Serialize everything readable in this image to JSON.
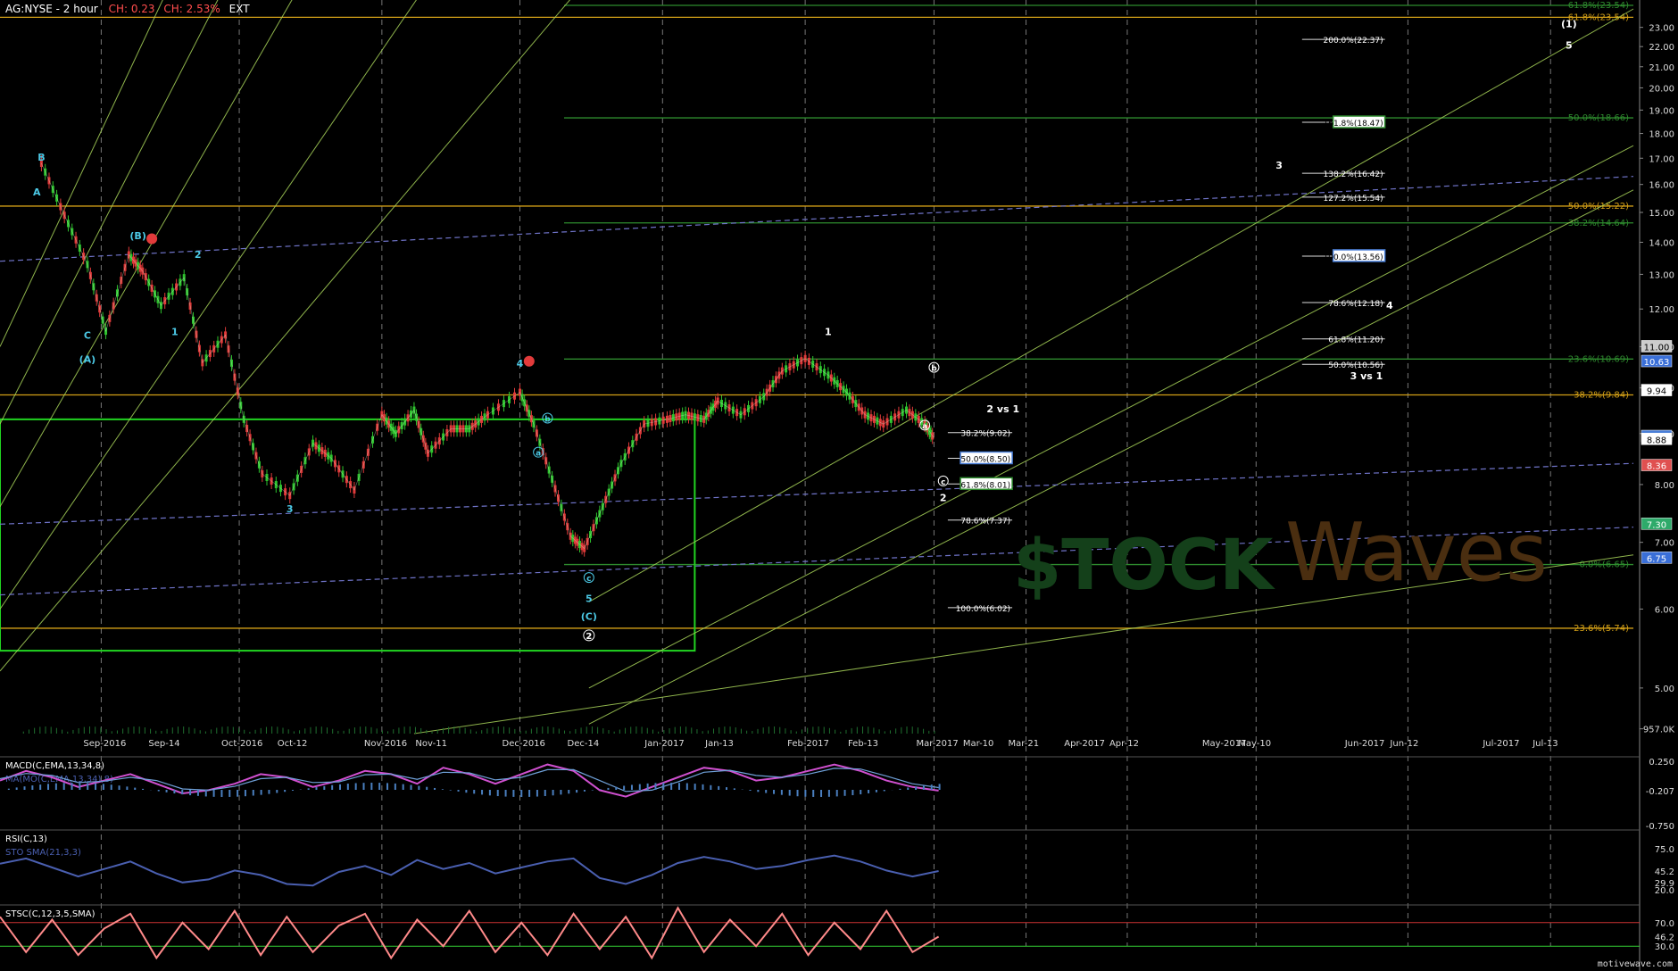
{
  "header": {
    "symbol": "AG:NYSE - 2 hour",
    "change_abs": "CH: 0.23",
    "change_pct": "CH: 2.53%",
    "session": "EXT",
    "ticker_tag": "AG"
  },
  "footer": {
    "brand": "motivewave.com"
  },
  "watermark": {
    "text_left": "$TOCK",
    "text_right": "Waves"
  },
  "colors": {
    "background": "#000000",
    "gold": "#d4a017",
    "green_line": "#2e8b2e",
    "box": "#21d421",
    "trend": "#a8d45a",
    "dashed_blue": "#6f73c8",
    "wave_cyan": "#4cc9e6",
    "alert_red": "#e23b3b",
    "macd": "#d050d0",
    "stsc": "#ff8a8a"
  },
  "chart_data": [
    {
      "type": "line",
      "title": "AG:NYSE - 2 hour",
      "price_axis": {
        "scale": "log",
        "ylim": [
          4.5,
          24.5
        ],
        "ticks": [
          "23.00",
          "22.00",
          "21.00",
          "20.00",
          "19.00",
          "18.00",
          "17.00",
          "16.00",
          "15.00",
          "14.00",
          "13.00",
          "12.00",
          "11.00",
          "10.00",
          "9.00",
          "8.00",
          "7.00",
          "6.00",
          "5.00",
          "957.0K"
        ],
        "labels": [
          {
            "text": "11.00",
            "value": 11.0,
            "color": "#cccccc"
          },
          {
            "text": "10.63",
            "value": 10.63,
            "color": "#3a6fd8"
          },
          {
            "text": "9.94",
            "value": 9.94,
            "color": "#ffffff"
          },
          {
            "text": "8.94",
            "value": 8.94,
            "color": "#4a7fd8"
          },
          {
            "text": "8.88",
            "value": 8.88,
            "color": "#ffffff"
          },
          {
            "text": "8.36",
            "value": 8.36,
            "color": "#e05050"
          },
          {
            "text": "7.30",
            "value": 7.3,
            "color": "#2eaa6a"
          },
          {
            "text": "6.75",
            "value": 6.75,
            "color": "#3a6fd8"
          }
        ]
      },
      "time_axis": {
        "labels": [
          "Sep-2016",
          "Sep-14",
          "Oct-2016",
          "Oct-12",
          "Nov-2016",
          "Nov-11",
          "Dec-2016",
          "Dec-14",
          "Jan-2017",
          "Jan-13",
          "Feb-2017",
          "Feb-13",
          "Mar-2017",
          "Mar-10",
          "Mar-21",
          "Apr-2017",
          "Apr-12",
          "May-2017",
          "May-10",
          "Jun-2017",
          "Jun-12",
          "Jul-2017",
          "Jul-13"
        ]
      },
      "series": [
        {
          "name": "AG",
          "x": [
            "Aug-19",
            "Aug-24",
            "Aug-29",
            "Sep-02",
            "Sep-07",
            "Sep-10",
            "Sep-14",
            "Sep-19",
            "Sep-23",
            "Sep-28",
            "Oct-02",
            "Oct-06",
            "Oct-12",
            "Oct-17",
            "Oct-21",
            "Oct-26",
            "Nov-01",
            "Nov-04",
            "Nov-08",
            "Nov-11",
            "Nov-16",
            "Nov-20",
            "Nov-24",
            "Dec-01",
            "Dec-04",
            "Dec-08",
            "Dec-12",
            "Dec-15",
            "Dec-19",
            "Dec-23",
            "Dec-28",
            "Jan-02",
            "Jan-06",
            "Jan-10",
            "Jan-13",
            "Jan-18",
            "Jan-23",
            "Jan-27",
            "Feb-01",
            "Feb-06",
            "Feb-10",
            "Feb-14",
            "Feb-18",
            "Feb-23",
            "Feb-27",
            "Mar-01"
          ],
          "values": [
            16.8,
            14.9,
            13.3,
            11.4,
            13.6,
            13.1,
            12.1,
            12.9,
            10.6,
            11.3,
            9.3,
            8.2,
            7.8,
            8.8,
            8.5,
            7.9,
            9.4,
            9.0,
            9.5,
            8.6,
            9.1,
            9.1,
            9.4,
            9.9,
            9.2,
            8.1,
            7.1,
            6.9,
            7.6,
            8.4,
            9.2,
            9.3,
            9.4,
            9.3,
            9.7,
            9.4,
            9.8,
            10.4,
            10.7,
            10.3,
            9.9,
            9.4,
            9.2,
            9.5,
            9.2,
            8.9
          ]
        }
      ],
      "horizontal_levels": [
        {
          "label": "61.8%(23.54)",
          "value": 23.54,
          "color": "#d4a017"
        },
        {
          "label": "50.0%(15.22)",
          "value": 15.22,
          "color": "#d4a017"
        },
        {
          "label": "38.2%(9.84)",
          "value": 9.84,
          "color": "#d4a017"
        },
        {
          "label": "23.6%(5.74)",
          "value": 5.74,
          "color": "#d4a017"
        },
        {
          "label": "61.8%(23.54)",
          "value": 24.2,
          "color": "#2e8b2e"
        },
        {
          "label": "50.0%(18.66)",
          "value": 18.66,
          "color": "#2e8b2e"
        },
        {
          "label": "38.2%(14.64)",
          "value": 14.64,
          "color": "#2e8b2e"
        },
        {
          "label": "23.6%(10.69)",
          "value": 10.69,
          "color": "#2e8b2e"
        },
        {
          "label": "0.0%(6.65)",
          "value": 6.65,
          "color": "#2e8b2e"
        }
      ],
      "fib_targets_upper": [
        {
          "label": "200.0%(22.37)",
          "value": 22.37,
          "boxed": false
        },
        {
          "label": "161.8%(18.47)",
          "value": 18.47,
          "boxed": true,
          "box_color": "#2e8b2e"
        },
        {
          "label": "138.2%(16.42)",
          "value": 16.42,
          "boxed": false
        },
        {
          "label": "127.2%(15.54)",
          "value": 15.54,
          "boxed": false
        },
        {
          "label": "100.0%(13.56)",
          "value": 13.56,
          "boxed": true,
          "box_color": "#4a7fd8"
        },
        {
          "label": "78.6%(12.18)",
          "value": 12.18,
          "boxed": false
        },
        {
          "label": "61.8%(11.20)",
          "value": 11.2,
          "boxed": false
        },
        {
          "label": "50.0%(10.56)",
          "value": 10.56,
          "boxed": false
        }
      ],
      "fib_targets_lower": [
        {
          "label": "38.2%(9.02)",
          "value": 9.02,
          "boxed": false
        },
        {
          "label": "50.0%(8.50)",
          "value": 8.5,
          "boxed": true,
          "box_color": "#4a7fd8"
        },
        {
          "label": "61.8%(8.01)",
          "value": 8.01,
          "boxed": true,
          "box_color": "#2e8b2e"
        },
        {
          "label": "78.6%(7.37)",
          "value": 7.37,
          "boxed": false
        },
        {
          "label": "100.0%(6.02)",
          "value": 6.02,
          "boxed": false
        }
      ],
      "wave_labels": [
        {
          "text": "B",
          "date": "Aug-19",
          "value": 16.9,
          "color": "#4cc9e6"
        },
        {
          "text": "A",
          "date": "Aug-18",
          "value": 15.6,
          "color": "#4cc9e6"
        },
        {
          "text": "C",
          "date": "Aug-29",
          "value": 11.2,
          "color": "#4cc9e6"
        },
        {
          "text": "(A)",
          "date": "Aug-29",
          "value": 10.6,
          "color": "#4cc9e6"
        },
        {
          "text": "(B)",
          "date": "Sep-09",
          "value": 14.1,
          "color": "#4cc9e6"
        },
        {
          "text": "1",
          "date": "Sep-17",
          "value": 11.3,
          "color": "#4cc9e6"
        },
        {
          "text": "2",
          "date": "Sep-22",
          "value": 13.5,
          "color": "#4cc9e6"
        },
        {
          "text": "3",
          "date": "Oct-12",
          "value": 7.5,
          "color": "#4cc9e6"
        },
        {
          "text": "4",
          "date": "Dec-01",
          "value": 10.5,
          "color": "#4cc9e6"
        },
        {
          "text": "a",
          "date": "Dec-05",
          "value": 8.55,
          "color": "#4cc9e6"
        },
        {
          "text": "b",
          "date": "Dec-07",
          "value": 9.25,
          "color": "#4cc9e6"
        },
        {
          "text": "c",
          "date": "Dec-16",
          "value": 6.4,
          "color": "#4cc9e6"
        },
        {
          "text": "5",
          "date": "Dec-16",
          "value": 6.1,
          "color": "#4cc9e6"
        },
        {
          "text": "(C)",
          "date": "Dec-16",
          "value": 5.85,
          "color": "#4cc9e6"
        },
        {
          "text": "2",
          "date": "Dec-16",
          "value": 5.6,
          "color": "#ffffff"
        },
        {
          "text": "1",
          "date": "Feb-06",
          "value": 11.3,
          "color": "#ffffff"
        },
        {
          "text": "a",
          "date": "Feb-27",
          "value": 9.1,
          "color": "#ffffff"
        },
        {
          "text": "b",
          "date": "Mar-01",
          "value": 10.4,
          "color": "#ffffff"
        },
        {
          "text": "c",
          "date": "Mar-03",
          "value": 8.0,
          "color": "#ffffff"
        },
        {
          "text": "2",
          "date": "Mar-03",
          "value": 7.7,
          "color": "#ffffff"
        },
        {
          "text": "2 vs 1",
          "date": "Mar-16",
          "value": 9.45,
          "color": "#ffffff"
        },
        {
          "text": "3",
          "date": "May-15",
          "value": 16.6,
          "color": "#ffffff"
        },
        {
          "text": "4",
          "date": "Jun-08",
          "value": 12.0,
          "color": "#ffffff"
        },
        {
          "text": "3 vs 1",
          "date": "Jun-03",
          "value": 10.2,
          "color": "#ffffff"
        },
        {
          "text": "(1)",
          "date": "Jul-17",
          "value": 23.0,
          "color": "#ffffff"
        },
        {
          "text": "5",
          "date": "Jul-17",
          "value": 21.9,
          "color": "#ffffff"
        }
      ]
    },
    {
      "type": "line",
      "title": "MACD(C,EMA,13,34,8)",
      "legend": [
        "MACD(C,EMA,13,34,8)",
        "MA(MO(C,EMA,13,34),8)"
      ],
      "ylim": [
        -0.82,
        0.32
      ],
      "ticks": [
        "0.250",
        "-0.207",
        "-0.750"
      ],
      "series": [
        {
          "name": "MACD(C,EMA,13,34,8)",
          "values": [
            -0.05,
            0.1,
            0.0,
            -0.15,
            -0.05,
            0.05,
            -0.1,
            -0.25,
            -0.2,
            -0.1,
            0.05,
            0.0,
            -0.15,
            -0.05,
            0.1,
            0.05,
            -0.1,
            0.15,
            0.05,
            -0.1,
            0.05,
            0.2,
            0.1,
            -0.2,
            -0.3,
            -0.15,
            0.0,
            0.15,
            0.1,
            -0.05,
            0.0,
            0.1,
            0.2,
            0.1,
            -0.05,
            -0.15,
            -0.207
          ]
        },
        {
          "name": "MA(MO(C,EMA,13,34),8)",
          "values": [
            -0.02,
            0.06,
            0.03,
            -0.08,
            -0.06,
            0.0,
            -0.05,
            -0.18,
            -0.2,
            -0.14,
            -0.02,
            0.0,
            -0.08,
            -0.07,
            0.04,
            0.05,
            -0.03,
            0.08,
            0.07,
            -0.04,
            0.0,
            0.12,
            0.12,
            -0.05,
            -0.22,
            -0.2,
            -0.07,
            0.08,
            0.11,
            0.03,
            0.0,
            0.05,
            0.14,
            0.13,
            0.02,
            -0.1,
            -0.16
          ]
        }
      ]
    },
    {
      "type": "line",
      "title": "RSI(C,13)",
      "legend": [
        "RSI(C,13)",
        "STO SMA(21,3,3)"
      ],
      "ylim": [
        0,
        100
      ],
      "ticks": [
        "75.0",
        "45.2",
        "29.9",
        "20.0"
      ],
      "series": [
        {
          "name": "RSI(C,13)",
          "values": [
            55,
            62,
            50,
            38,
            48,
            58,
            42,
            30,
            34,
            46,
            40,
            28,
            26,
            44,
            52,
            40,
            60,
            48,
            56,
            42,
            50,
            58,
            62,
            36,
            28,
            40,
            56,
            64,
            58,
            48,
            52,
            60,
            66,
            58,
            46,
            38,
            45.2
          ]
        }
      ]
    },
    {
      "type": "line",
      "title": "STSC(C,12,3,5,SMA)",
      "ylim": [
        0,
        100
      ],
      "ticks": [
        "70.0",
        "46.2",
        "30.0"
      ],
      "levels": [
        70,
        30
      ],
      "series": [
        {
          "name": "STSC(C,12,3,5,SMA)",
          "values": [
            80,
            20,
            75,
            15,
            60,
            85,
            10,
            70,
            25,
            90,
            15,
            80,
            20,
            65,
            85,
            10,
            75,
            30,
            90,
            20,
            70,
            15,
            85,
            25,
            80,
            10,
            95,
            20,
            75,
            30,
            85,
            15,
            70,
            25,
            90,
            20,
            46.2
          ]
        }
      ]
    }
  ]
}
